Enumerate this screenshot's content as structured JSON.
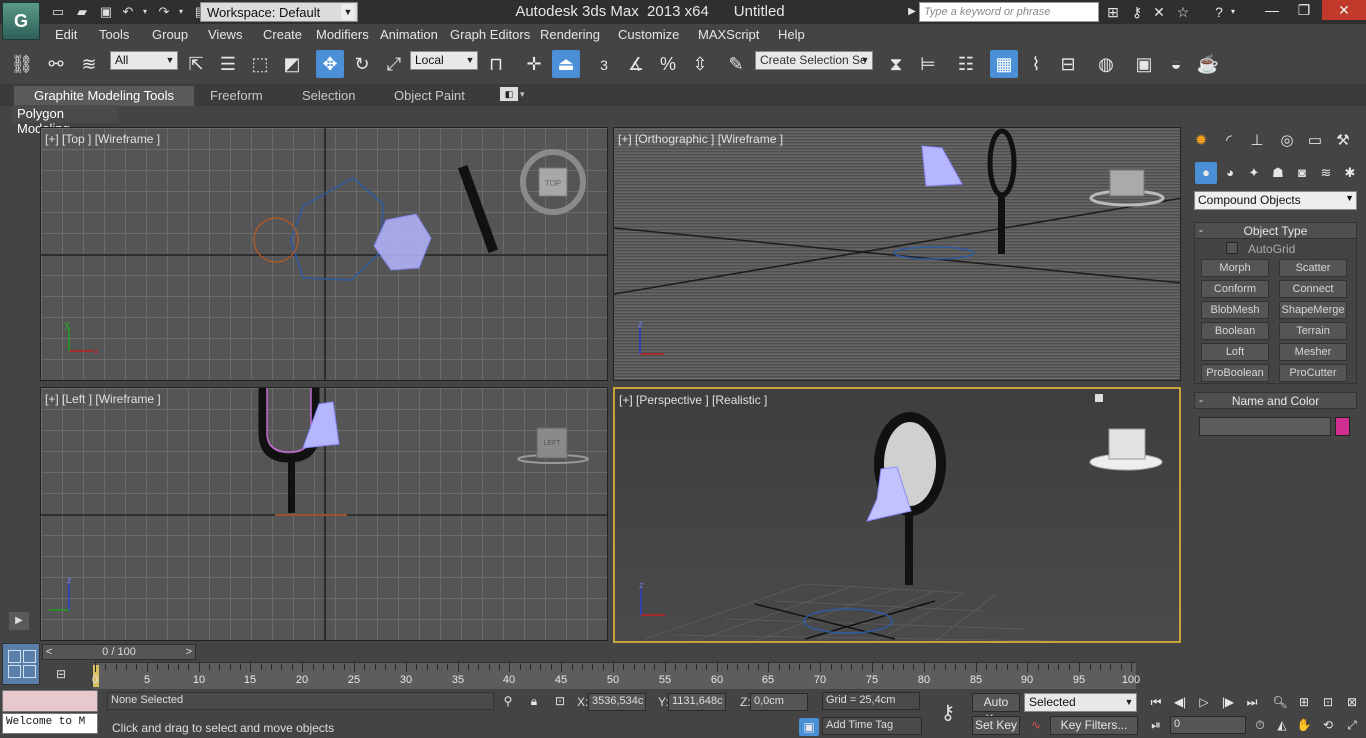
{
  "titlebar": {
    "logo": "G",
    "workspace": "Workspace: Default",
    "title": "Autodesk 3ds Max  2013 x64      Untitled",
    "search_placeholder": "Type a keyword or phrase"
  },
  "menus": [
    "Edit",
    "Tools",
    "Group",
    "Views",
    "Create",
    "Modifiers",
    "Animation",
    "Graph Editors",
    "Rendering",
    "Customize",
    "MAXScript",
    "Help"
  ],
  "toolbar": {
    "filter": "All",
    "coord_system": "Local",
    "snap_label": "3",
    "selection_set_placeholder": "Create Selection Se"
  },
  "ribbon": {
    "tabs": [
      "Graphite Modeling Tools",
      "Freeform",
      "Selection",
      "Object Paint"
    ],
    "panel": "Polygon Modeling"
  },
  "viewports": {
    "top": "[+] [Top ] [Wireframe ]",
    "ortho": "[+] [Orthographic ] [Wireframe ]",
    "left": "[+] [Left ] [Wireframe ]",
    "persp": "[+] [Perspective ] [Realistic ]",
    "viewcube_top": "TOP",
    "viewcube_left": "LEFT"
  },
  "command_panel": {
    "category": "Compound Objects",
    "object_type_title": "Object Type",
    "autogrid": "AutoGrid",
    "buttons": [
      "Morph",
      "Scatter",
      "Conform",
      "Connect",
      "BlobMesh",
      "ShapeMerge",
      "Boolean",
      "Terrain",
      "Loft",
      "Mesher",
      "ProBoolean",
      "ProCutter"
    ],
    "name_color_title": "Name and Color",
    "object_color": "#d02f8f"
  },
  "timeline": {
    "frame_display": "0 / 100",
    "ticks": [
      "0",
      "5",
      "10",
      "15",
      "20",
      "25",
      "30",
      "35",
      "40",
      "45",
      "50",
      "55",
      "60",
      "65",
      "70",
      "75",
      "80",
      "85",
      "90",
      "95",
      "100"
    ]
  },
  "status": {
    "listener_text": "Welcome to M",
    "selection": "None Selected",
    "prompt": "Click and drag to select and move objects",
    "x_label": "X:",
    "x_value": "3536,534c",
    "y_label": "Y:",
    "y_value": "1131,648c",
    "z_label": "Z:",
    "z_value": "0,0cm",
    "grid": "Grid = 25,4cm",
    "add_time_tag": "Add Time Tag",
    "auto_key": "Auto Key",
    "set_key": "Set Key",
    "key_mode": "Selected",
    "key_filters": "Key Filters...",
    "current_frame": "0"
  }
}
